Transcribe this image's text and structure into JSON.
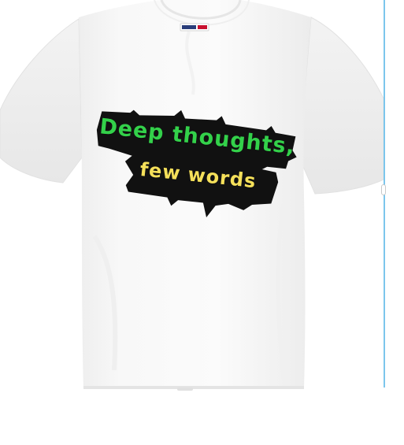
{
  "shirt": {
    "color": "#f7f7f7",
    "tag_color": "#2a3d7a"
  },
  "design": {
    "line1": "Deep thoughts,",
    "line2": "few words",
    "line1_color": "#33d14a",
    "line2_color": "#f5e05a",
    "backdrop_color": "#111111"
  },
  "frame": {
    "accent_color": "#7cc6ec"
  }
}
